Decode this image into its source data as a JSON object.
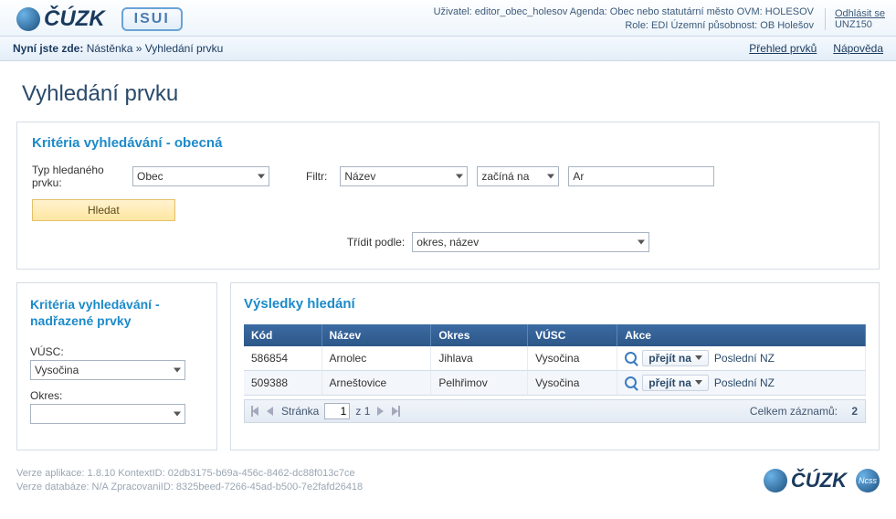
{
  "header": {
    "logo1": "ČÚZK",
    "logo2": "ISUI",
    "user_line": "Uživatel: editor_obec_holesov   Agenda: Obec nebo statutární město   OVM: HOLESOV",
    "role_line": "Role: EDI   Územní působnost: OB Holešov",
    "logout": "Odhlásit se",
    "logout_code": "UNZ150"
  },
  "breadcrumb": {
    "label": "Nyní jste zde:",
    "path": "Nástěnka » Vyhledání prvku",
    "link_overview": "Přehled prvků",
    "link_help": "Nápověda"
  },
  "page_title": "Vyhledání prvku",
  "criteria": {
    "title": "Kritéria vyhledávání - obecná",
    "type_label": "Typ hledaného prvku:",
    "type_value": "Obec",
    "filter_label": "Filtr:",
    "filter_attr": "Název",
    "filter_op": "začíná na",
    "filter_value": "Ar",
    "search_btn": "Hledat",
    "sort_label": "Třídit podle:",
    "sort_value": "okres, název"
  },
  "parent_criteria": {
    "title": "Kritéria vyhledávání - nadřazené prvky",
    "vusc_label": "VÚSC:",
    "vusc_value": "Vysočina",
    "okres_label": "Okres:",
    "okres_value": ""
  },
  "results": {
    "title": "Výsledky hledání",
    "columns": {
      "kod": "Kód",
      "nazev": "Název",
      "okres": "Okres",
      "vusc": "VÚSC",
      "akce": "Akce"
    },
    "action_go": "přejít na",
    "action_last": "Poslední NZ",
    "rows": [
      {
        "kod": "586854",
        "nazev": "Arnolec",
        "okres": "Jihlava",
        "vusc": "Vysočina"
      },
      {
        "kod": "509388",
        "nazev": "Arneštovice",
        "okres": "Pelhřimov",
        "vusc": "Vysočina"
      }
    ],
    "pager": {
      "page_label": "Stránka",
      "page": "1",
      "of": "z 1",
      "total_label": "Celkem záznamů:",
      "total": "2"
    }
  },
  "footer": {
    "line1": "Verze aplikace: 1.8.10 KontextID: 02db3175-b69a-456c-8462-dc88f013c7ce",
    "line2": "Verze databáze: N/A ZpracovaniID: 8325beed-7266-45ad-b500-7e2fafd26418",
    "ncss": "Ncss"
  }
}
